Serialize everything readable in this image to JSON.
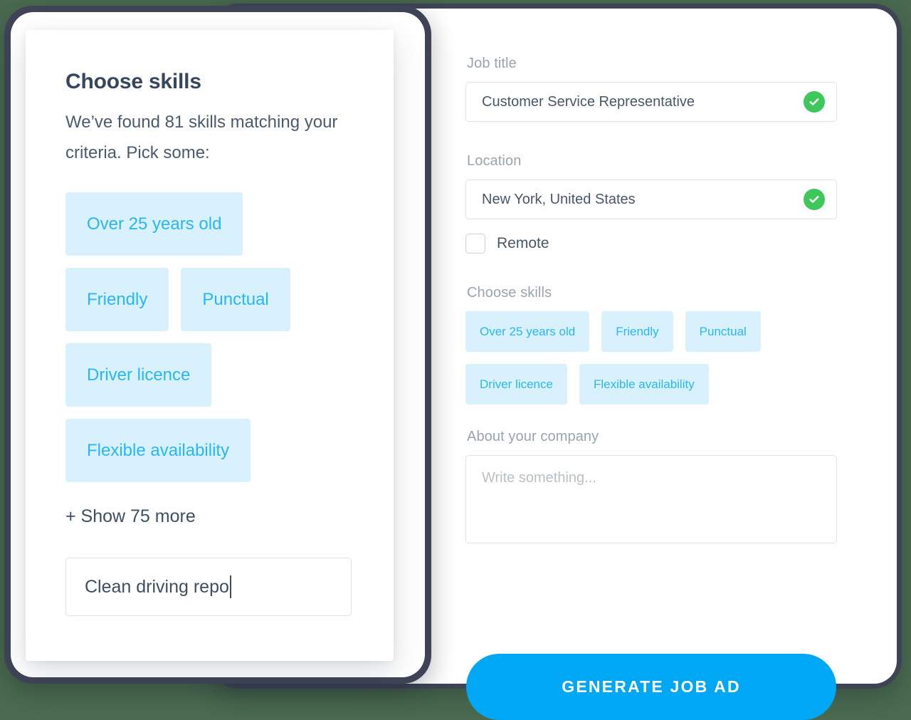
{
  "background_color": "#4a6b4f",
  "accent_color": "#00a7f5",
  "chip_bg_color": "#d9f1fc",
  "chip_text_color": "#29b6f6",
  "valid_color": "#3ec75a",
  "form": {
    "job_title": {
      "label": "Job title",
      "value": "Customer Service Representative",
      "valid_icon": "check-circle-icon"
    },
    "location": {
      "label": "Location",
      "value": "New York, United States",
      "valid_icon": "check-circle-icon"
    },
    "remote": {
      "label": "Remote",
      "checked": false
    },
    "skills": {
      "label": "Choose skills",
      "items": [
        "Over 25 years old",
        "Friendly",
        "Punctual",
        "Driver licence",
        "Flexible availability"
      ]
    },
    "about": {
      "label": "About your company",
      "value": "",
      "placeholder": "Write something..."
    },
    "submit_label": "GENERATE JOB AD"
  },
  "modal": {
    "title": "Choose skills",
    "subtitle": "We’ve found 81 skills matching your criteria. Pick some:",
    "skills": [
      "Over 25 years old",
      "Friendly",
      "Punctual",
      "Driver licence",
      "Flexible availability"
    ],
    "show_more_label": "+ Show 75 more",
    "input_value": "Clean driving repo",
    "input_placeholder": ""
  }
}
